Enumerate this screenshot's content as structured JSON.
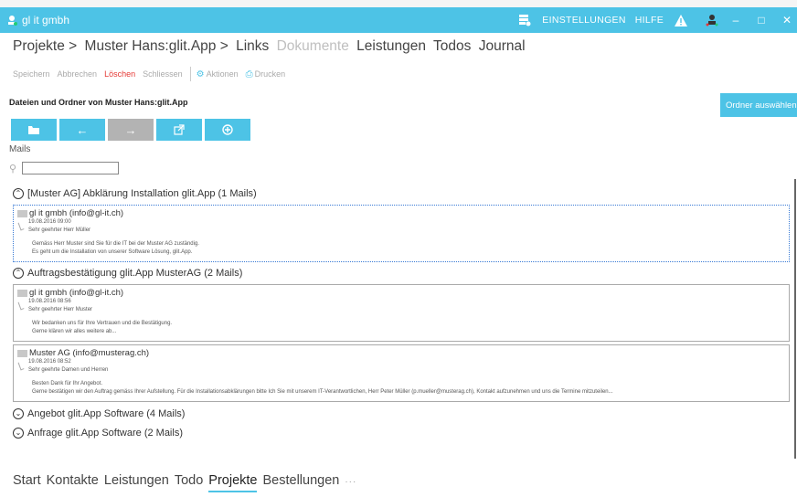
{
  "app": {
    "title": "gl it gmbh"
  },
  "titlebar": {
    "settings": "EINSTELLUNGEN",
    "help": "HILFE"
  },
  "breadcrumb": {
    "items": [
      {
        "label": "Projekte >"
      },
      {
        "label": "Muster Hans:glit.App >"
      },
      {
        "label": "Links"
      },
      {
        "label": "Dokumente",
        "dim": true
      },
      {
        "label": "Leistungen"
      },
      {
        "label": "Todos"
      },
      {
        "label": "Journal"
      }
    ]
  },
  "toolbar": {
    "save": "Speichern",
    "cancel": "Abbrechen",
    "delete": "Löschen",
    "close": "Schliessen",
    "actions": "Aktionen",
    "print": "Drucken"
  },
  "section": {
    "title": "Dateien und Ordner von Muster Hans:glit.App",
    "choose_folder": "Ordner auswählen"
  },
  "mails_label": "Mails",
  "search": {
    "value": "",
    "placeholder": ""
  },
  "groups": [
    {
      "title": "[Muster AG] Abklärung Installation glit.App",
      "count": "(1 Mails)",
      "expanded": true,
      "mails": [
        {
          "from": "gl it gmbh (info@gl-it.ch)",
          "date": "19.08.2016 09:00",
          "greeting": "Sehr geehrter Herr Müller",
          "line1": "Gemäss Herr Muster sind Sie für die IT bei der Muster AG zuständig.",
          "line2": "Es geht um die Installation von unserer Software Lösung, glit.App.",
          "selected": true
        }
      ]
    },
    {
      "title": "Auftragsbestätigung glit.App MusterAG",
      "count": "(2 Mails)",
      "expanded": true,
      "mails": [
        {
          "from": "gl it gmbh (info@gl-it.ch)",
          "date": "19.08.2016 08:56",
          "greeting": "Sehr geehrter Herr Muster",
          "line1": "Wir bedanken uns für Ihre Vertrauen und die Bestätigung.",
          "line2": "Gerne klären wir alles weitere ab...",
          "selected": false
        },
        {
          "from": "Muster AG (info@musterag.ch)",
          "date": "19.08.2016 08:52",
          "greeting": "Sehr geehrte Damen und Herren",
          "line1": "Besten Dank für Ihr Angebot.",
          "line2": "Gerne bestätigen wir den Auftrag gemäss Ihrer Aufstellung. Für die Installationsabklärungen bitte Ich Sie mit unserem IT-Verantwortlichen, Herr Peter Müller (p.mueller@musterag.ch), Kontakt aufzunehmen und uns die Termine mitzuteilen...",
          "selected": false
        }
      ]
    },
    {
      "title": "Angebot glit.App Software",
      "count": "(4 Mails)",
      "expanded": false,
      "mails": []
    },
    {
      "title": "Anfrage glit.App Software",
      "count": "(2 Mails)",
      "expanded": false,
      "mails": []
    }
  ],
  "bottom_nav": {
    "items": [
      {
        "label": "Start"
      },
      {
        "label": "Kontakte"
      },
      {
        "label": "Leistungen"
      },
      {
        "label": "Todo"
      },
      {
        "label": "Projekte",
        "active": true
      },
      {
        "label": "Bestellungen"
      }
    ],
    "more": "···"
  },
  "colors": {
    "accent": "#4dc3e6",
    "delete": "#e53935",
    "disabled": "#b3b3b3"
  }
}
